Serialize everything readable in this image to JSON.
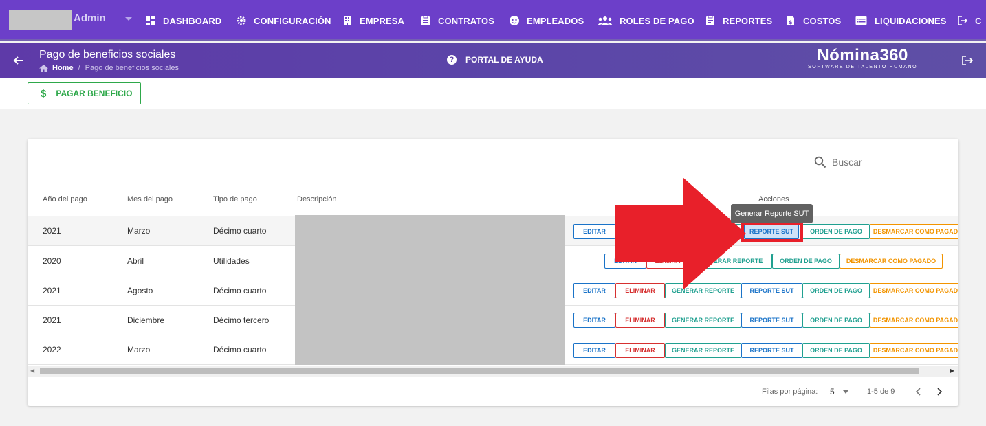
{
  "user": {
    "name": "Admin"
  },
  "nav": [
    {
      "label": "DASHBOARD",
      "icon": "dashboard-icon"
    },
    {
      "label": "CONFIGURACIÓN",
      "icon": "gear-icon"
    },
    {
      "label": "EMPRESA",
      "icon": "building-icon"
    },
    {
      "label": "CONTRATOS",
      "icon": "clipboard-icon"
    },
    {
      "label": "EMPLEADOS",
      "icon": "face-icon"
    },
    {
      "label": "ROLES DE PAGO",
      "icon": "users-icon"
    },
    {
      "label": "REPORTES",
      "icon": "report-icon"
    },
    {
      "label": "COSTOS",
      "icon": "invoice-icon"
    },
    {
      "label": "LIQUIDACIONES",
      "icon": "list-icon"
    },
    {
      "label": "C",
      "icon": "logout-icon"
    }
  ],
  "header": {
    "title": "Pago de beneficios sociales",
    "breadcrumb_home": "Home",
    "breadcrumb_sep": "/",
    "breadcrumb_current": "Pago de beneficios sociales",
    "help_label": "PORTAL DE AYUDA",
    "brand_name": "Nómina360",
    "brand_tagline": "SOFTWARE DE TALENTO HUMANO"
  },
  "toolbar": {
    "pay_label": "PAGAR BENEFICIO",
    "pay_icon": "$"
  },
  "search": {
    "placeholder": "Buscar"
  },
  "table": {
    "headers": {
      "year": "Año del pago",
      "month": "Mes del pago",
      "type": "Tipo de pago",
      "description": "Descripción",
      "actions": "Acciones"
    },
    "rows": [
      {
        "year": "2021",
        "month": "Marzo",
        "type": "Décimo cuarto"
      },
      {
        "year": "2020",
        "month": "Abril",
        "type": "Utilidades"
      },
      {
        "year": "2021",
        "month": "Agosto",
        "type": "Décimo cuarto"
      },
      {
        "year": "2021",
        "month": "Diciembre",
        "type": "Décimo tercero"
      },
      {
        "year": "2022",
        "month": "Marzo",
        "type": "Décimo cuarto"
      }
    ],
    "actions": {
      "edit": "EDITAR",
      "delete": "ELIMINAR",
      "generate": "GENERAR REPORTE",
      "sut": "REPORTE SUT",
      "order": "ORDEN DE PAGO",
      "unmark": "DESMARCAR COMO PAGADO",
      "row2_delete_partial": "ELIMINA",
      "row2_generate_partial": "ERAR REPORTE"
    }
  },
  "pagination": {
    "rows_label": "Filas por página:",
    "rows_value": "5",
    "range": "1-5 de 9"
  },
  "tooltip": "Generar Reporte SUT",
  "colors": {
    "nav_bg": "#6c3fc9",
    "header_bg": "#5e3aa8",
    "green": "#2ea84a",
    "blue": "#1a73c8",
    "red": "#d63030",
    "teal": "#20a090",
    "orange": "#f29400",
    "arrow": "#e8202a"
  }
}
